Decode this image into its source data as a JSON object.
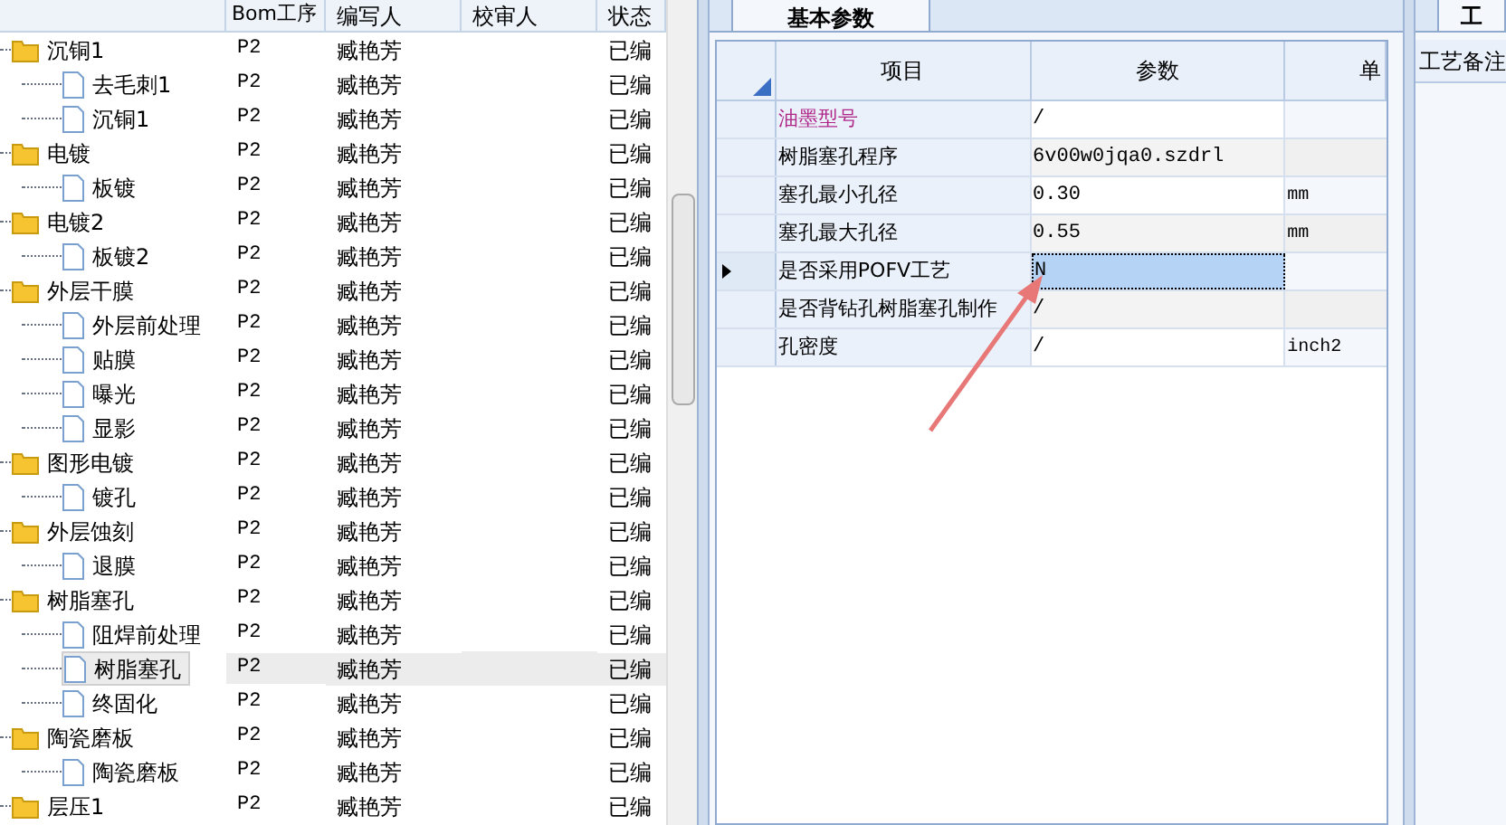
{
  "tree_grid": {
    "columns": [
      "Bom工序",
      "编写人",
      "校审人",
      "状态"
    ],
    "rows": [
      {
        "name": "沉铜1",
        "bom": "P2",
        "writer": "臧艳芳",
        "status": "已编",
        "children": [
          {
            "name": "去毛刺1",
            "bom": "P2",
            "writer": "臧艳芳",
            "status": "已编",
            "selected": false
          },
          {
            "name": "沉铜1",
            "bom": "P2",
            "writer": "臧艳芳",
            "status": "已编",
            "selected": false
          }
        ]
      },
      {
        "name": "电镀",
        "bom": "P2",
        "writer": "臧艳芳",
        "status": "已编",
        "children": [
          {
            "name": "板镀",
            "bom": "P2",
            "writer": "臧艳芳",
            "status": "已编",
            "selected": false
          }
        ]
      },
      {
        "name": "电镀2",
        "bom": "P2",
        "writer": "臧艳芳",
        "status": "已编",
        "children": [
          {
            "name": "板镀2",
            "bom": "P2",
            "writer": "臧艳芳",
            "status": "已编",
            "selected": false
          }
        ]
      },
      {
        "name": "外层干膜",
        "bom": "P2",
        "writer": "臧艳芳",
        "status": "已编",
        "children": [
          {
            "name": "外层前处理",
            "bom": "P2",
            "writer": "臧艳芳",
            "status": "已编",
            "selected": false
          },
          {
            "name": "贴膜",
            "bom": "P2",
            "writer": "臧艳芳",
            "status": "已编",
            "selected": false
          },
          {
            "name": "曝光",
            "bom": "P2",
            "writer": "臧艳芳",
            "status": "已编",
            "selected": false
          },
          {
            "name": "显影",
            "bom": "P2",
            "writer": "臧艳芳",
            "status": "已编",
            "selected": false
          }
        ]
      },
      {
        "name": "图形电镀",
        "bom": "P2",
        "writer": "臧艳芳",
        "status": "已编",
        "children": [
          {
            "name": "镀孔",
            "bom": "P2",
            "writer": "臧艳芳",
            "status": "已编",
            "selected": false
          }
        ]
      },
      {
        "name": "外层蚀刻",
        "bom": "P2",
        "writer": "臧艳芳",
        "status": "已编",
        "children": [
          {
            "name": "退膜",
            "bom": "P2",
            "writer": "臧艳芳",
            "status": "已编",
            "selected": false
          }
        ]
      },
      {
        "name": "树脂塞孔",
        "bom": "P2",
        "writer": "臧艳芳",
        "status": "已编",
        "children": [
          {
            "name": "阻焊前处理",
            "bom": "P2",
            "writer": "臧艳芳",
            "status": "已编",
            "selected": false
          },
          {
            "name": "树脂塞孔",
            "bom": "P2",
            "writer": "臧艳芳",
            "status": "已编",
            "selected": true
          },
          {
            "name": "终固化",
            "bom": "P2",
            "writer": "臧艳芳",
            "status": "已编",
            "selected": false
          }
        ]
      },
      {
        "name": "陶瓷磨板",
        "bom": "P2",
        "writer": "臧艳芳",
        "status": "已编",
        "children": [
          {
            "name": "陶瓷磨板",
            "bom": "P2",
            "writer": "臧艳芳",
            "status": "已编",
            "selected": false
          }
        ]
      },
      {
        "name": "层压1",
        "bom": "P2",
        "writer": "臧艳芳",
        "status": "已编",
        "children": []
      }
    ]
  },
  "params_panel": {
    "tab": "基本参数",
    "columns": [
      "项目",
      "参数",
      "单"
    ],
    "rows": [
      {
        "item": "油墨型号",
        "value": "/",
        "unit": "",
        "highlighted": true,
        "current": false
      },
      {
        "item": "树脂塞孔程序",
        "value": "6v00w0jqa0.szdrl",
        "unit": "",
        "highlighted": false,
        "current": false
      },
      {
        "item": "塞孔最小孔径",
        "value": "0.30",
        "unit": "mm",
        "highlighted": false,
        "current": false
      },
      {
        "item": "塞孔最大孔径",
        "value": "0.55",
        "unit": "mm",
        "highlighted": false,
        "current": false
      },
      {
        "item": "是否采用POFV工艺",
        "value": "N",
        "unit": "",
        "highlighted": false,
        "current": true
      },
      {
        "item": "是否背钻孔树脂塞孔制作",
        "value": "/",
        "unit": "",
        "highlighted": false,
        "current": false
      },
      {
        "item": "孔密度",
        "value": "/",
        "unit": "inch2",
        "highlighted": false,
        "current": false
      }
    ]
  },
  "notes_panel": {
    "tab": "工",
    "label": "工艺备注"
  }
}
